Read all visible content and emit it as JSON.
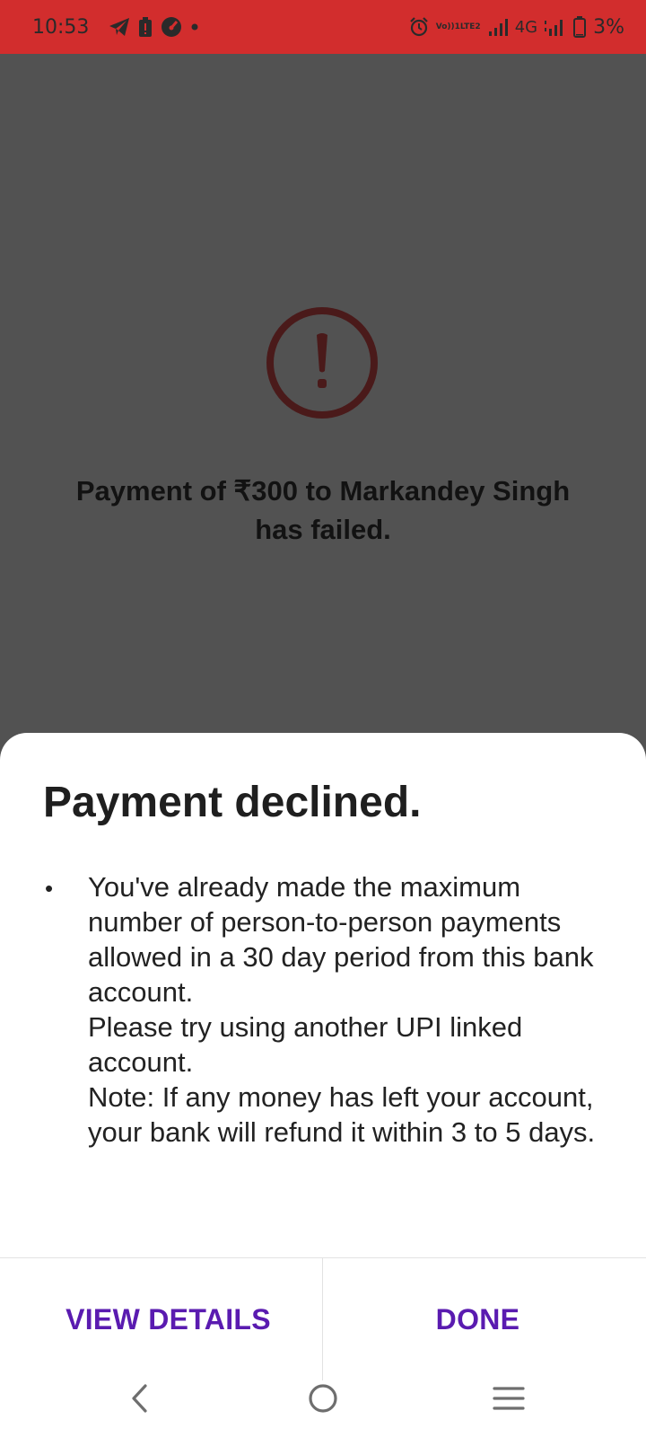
{
  "status_bar": {
    "time": "10:53",
    "network": "4G",
    "battery": "3%",
    "icons_left": [
      "telegram-icon",
      "battery-alert-icon",
      "speedometer-icon",
      "dot-icon"
    ],
    "icons_right": [
      "alarm-icon",
      "volte-icon",
      "signal-icon",
      "signal-icon",
      "battery-icon"
    ],
    "volte_line1": "Vo))1",
    "volte_line2": "LTE2",
    "color": "#d22d2d"
  },
  "background": {
    "icon": "exclamation-circle-icon",
    "message": "Payment of ₹300 to Markandey Singh has failed."
  },
  "sheet": {
    "title": "Payment declined.",
    "bullet": "•",
    "message": "You've already made the maximum number of person-to-person payments allowed in a 30 day period from this bank account.\nPlease try using another UPI linked account.\nNote: If any money has left your account, your bank will refund it within 3 to 5 days.",
    "buttons": {
      "view_details": "VIEW DETAILS",
      "done": "DONE"
    },
    "accent_color": "#5a1bb0"
  },
  "nav_bar": {
    "icons": [
      "back-icon",
      "home-icon",
      "menu-icon"
    ]
  }
}
